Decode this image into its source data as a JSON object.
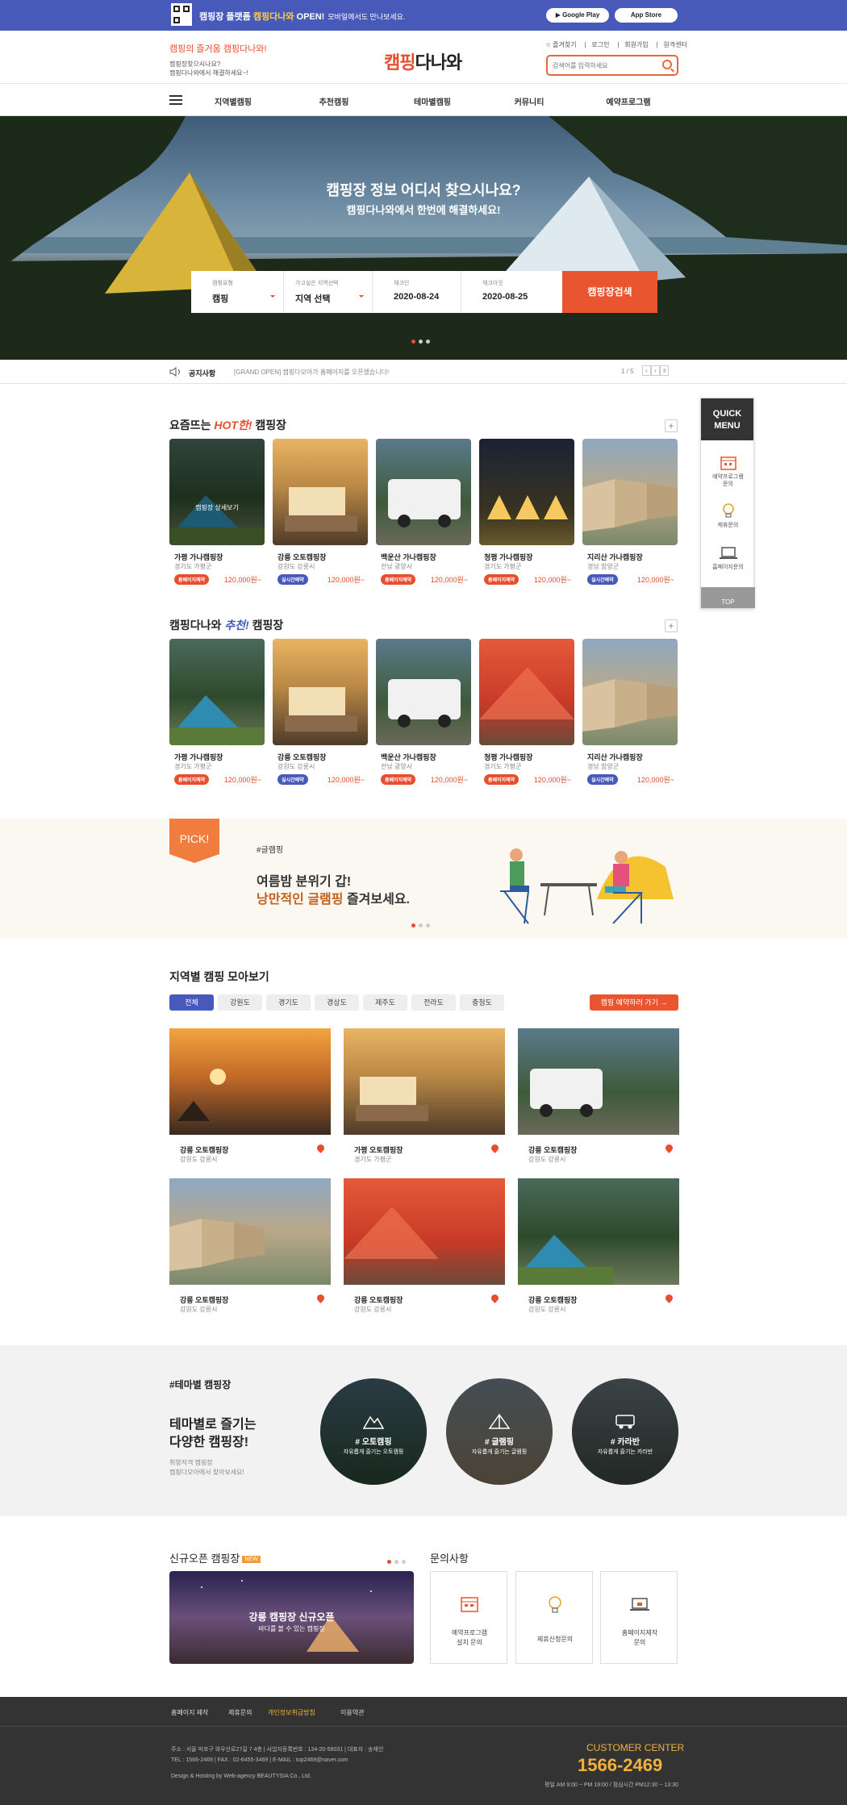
{
  "topbar": {
    "msg_prefix": "캠핑장 플랫폼 ",
    "msg_brand": "캠핑다나와",
    "msg_suffix": " OPEN!",
    "msg_small": "모바일에서도 만나보세요.",
    "google_play": "Google Play",
    "app_store": "App Store"
  },
  "header": {
    "tagline_prefix": "캠핑의 즐거움 ",
    "tagline_brand": "캠핑다나와!",
    "sub_line1": "캠핑장찾으시나요?",
    "sub_line2": "캠핑다나와에서 해결하세요~!",
    "logo_red": "캠핑",
    "logo_black": "다나와",
    "util": [
      "즐겨찾기",
      "로그인",
      "회원가입",
      "원격센터"
    ],
    "search_placeholder": "검색어를 입력하세요"
  },
  "nav": [
    "지역별캠핑",
    "추천캠핑",
    "테마별캠핑",
    "커뮤니티",
    "예약프로그램"
  ],
  "hero": {
    "title": "캠핑장 정보 어디서 찾으시나요?",
    "subtitle": "캠핑다나와에서 한번에 해결하세요!",
    "fields": [
      {
        "label": "캠핑유형",
        "value": "캠핑"
      },
      {
        "label": "가고싶은 지역선택",
        "value": "지역 선택"
      },
      {
        "label": "체크인",
        "value": "2020-08-24"
      },
      {
        "label": "체크아웃",
        "value": "2020-08-25"
      }
    ],
    "search_button": "캠핑장검색"
  },
  "notice": {
    "label": "공지사항",
    "text": "[GRAND OPEN] 캠핑다모아가 홈페이지를 오픈했습니다!",
    "page": "1 / 5"
  },
  "hot": {
    "title_prefix": "요즘뜨는 ",
    "title_em": "HOT한!",
    "title_suffix": " 캠핑장",
    "overlay_label": "캠핑장 상세보기",
    "items": [
      {
        "name": "가평 가나캠핑장",
        "region": "경기도 가평군",
        "badge": "홈페이지예약",
        "price": "120,000원~"
      },
      {
        "name": "강릉 오토캠핑장",
        "region": "강원도 강릉시",
        "badge": "실시간예약",
        "price": "120,000원~"
      },
      {
        "name": "백운산 가나캠핑장",
        "region": "전남 광양시",
        "badge": "홈페이지예약",
        "price": "120,000원~"
      },
      {
        "name": "청평 가나캠핑장",
        "region": "경기도 가평군",
        "badge": "홈페이지예약",
        "price": "120,000원~"
      },
      {
        "name": "지리산 가나캠핑장",
        "region": "경남 함양군",
        "badge": "실시간예약",
        "price": "120,000원~"
      }
    ]
  },
  "recommend": {
    "title_prefix": "캠핑다나와 ",
    "title_em": "추천!",
    "title_suffix": " 캠핑장",
    "items": [
      {
        "name": "가평 가나캠핑장",
        "region": "경기도 가평군",
        "badge": "홈페이지예약",
        "price": "120,000원~"
      },
      {
        "name": "강릉 오토캠핑장",
        "region": "강원도 강릉시",
        "badge": "실시간예약",
        "price": "120,000원~"
      },
      {
        "name": "백운산 가나캠핑장",
        "region": "전남 광양시",
        "badge": "홈페이지예약",
        "price": "120,000원~"
      },
      {
        "name": "청평 가나캠핑장",
        "region": "경기도 가평군",
        "badge": "홈페이지예약",
        "price": "120,000원~"
      },
      {
        "name": "지리산 가나캠핑장",
        "region": "경남 함양군",
        "badge": "실시간예약",
        "price": "120,000원~"
      }
    ]
  },
  "quick": {
    "title_line1": "QUICK",
    "title_line2": "MENU",
    "items": [
      {
        "line1": "예약프로그램",
        "line2": "문의"
      },
      {
        "line1": "제휴문의",
        "line2": ""
      },
      {
        "line1": "홈페이지문의",
        "line2": ""
      }
    ],
    "top": "TOP"
  },
  "pick": {
    "flag": "PICK!",
    "tag": "#글램핑",
    "line1": "여름밤 분위기 갑!",
    "line2_em": "낭만적인 글램핑",
    "line2_rest": " 즐겨보세요."
  },
  "region": {
    "title": "지역별 캠핑 모아보기",
    "chips": [
      "전체",
      "강원도",
      "경기도",
      "경상도",
      "제주도",
      "전라도",
      "충청도"
    ],
    "go_button": "캠핑 예약하러 가기",
    "items": [
      {
        "name": "강릉 오토캠핑장",
        "region": "강원도 강릉시"
      },
      {
        "name": "가평 오토캠핑장",
        "region": "경기도 가평군"
      },
      {
        "name": "강릉 오토캠핑장",
        "region": "강원도 강릉시"
      },
      {
        "name": "강릉 오토캠핑장",
        "region": "강원도 강릉시"
      },
      {
        "name": "강릉 오토캠핑장",
        "region": "강원도 강릉시"
      },
      {
        "name": "강릉 오토캠핑장",
        "region": "강원도 강릉시"
      }
    ]
  },
  "theme": {
    "tag": "#테마별 캠핑장",
    "line1": "테마별로 즐기는",
    "line2": "다양한 캠핑장!",
    "sub1": "취향저격 캠핑장",
    "sub2": "캠핑다모아에서 찾아보세요!",
    "circles": [
      {
        "title": "# 오토캠핑",
        "sub": "자유롭게 즐기는 오토캠핑"
      },
      {
        "title": "# 글램핑",
        "sub": "자유롭게 즐기는 글램핑"
      },
      {
        "title": "# 카라반",
        "sub": "자유롭게 즐기는 카라반"
      }
    ]
  },
  "newopen": {
    "title": "신규오픈 캠핑장",
    "badge": "NEW",
    "banner_title": "강릉 캠핑장 신규오픈",
    "banner_sub": "바다를 볼 수 있는 캠핑장"
  },
  "inquiry": {
    "title": "문의사항",
    "items": [
      {
        "line1": "예약프로그램",
        "line2": "설치 문의"
      },
      {
        "line1": "제휴신청문의",
        "line2": ""
      },
      {
        "line1": "홈페이지제작",
        "line2": "문의"
      }
    ]
  },
  "footer": {
    "links": [
      "홈페이지 제작",
      "제휴문의",
      "개인정보취급방침",
      "이용약관"
    ],
    "addr": "주소 : 서울 마포구 와우산로27길 7 4층  |  사업자등록번호 : 134-20-58031  |  대표자 : 송재인",
    "tel": "TEL : 1566-2469  |  FAX : 02-6455-3469  |  E-MAIL : top2469@naver.com",
    "hosting": "Design & Hosting by Web-agency BEAUTYSIA Co., Ltd.",
    "cc_label": "CUSTOMER CENTER",
    "cc_tel": "1566-2469",
    "cc_hours": "평일 AM 9:00 ~ PM 19:00 / 점심시간 PM12:30 ~ 13:30"
  },
  "colors": {
    "brand_blue": "#4759b9",
    "accent_orange": "#e8552f",
    "badge_red": "#e84d2e",
    "badge_blue": "#4759b9"
  }
}
